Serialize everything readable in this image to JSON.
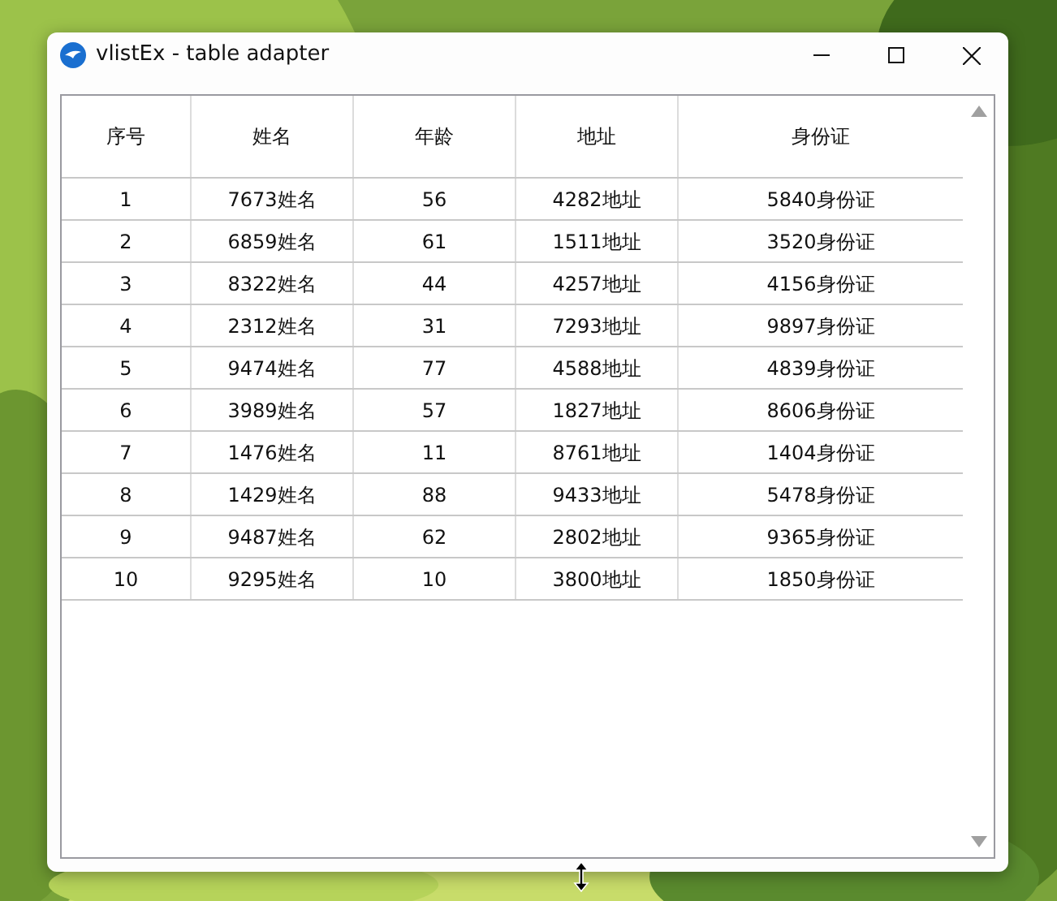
{
  "window": {
    "title": "vlistEx - table adapter"
  },
  "table": {
    "columns": [
      "序号",
      "姓名",
      "年龄",
      "地址",
      "身份证"
    ],
    "rows": [
      [
        "1",
        "7673姓名",
        "56",
        "4282地址",
        "5840身份证"
      ],
      [
        "2",
        "6859姓名",
        "61",
        "1511地址",
        "3520身份证"
      ],
      [
        "3",
        "8322姓名",
        "44",
        "4257地址",
        "4156身份证"
      ],
      [
        "4",
        "2312姓名",
        "31",
        "7293地址",
        "9897身份证"
      ],
      [
        "5",
        "9474姓名",
        "77",
        "4588地址",
        "4839身份证"
      ],
      [
        "6",
        "3989姓名",
        "57",
        "1827地址",
        "8606身份证"
      ],
      [
        "7",
        "1476姓名",
        "11",
        "8761地址",
        "1404身份证"
      ],
      [
        "8",
        "1429姓名",
        "88",
        "9433地址",
        "5478身份证"
      ],
      [
        "9",
        "9487姓名",
        "62",
        "2802地址",
        "9365身份证"
      ],
      [
        "10",
        "9295姓名",
        "10",
        "3800地址",
        "1850身份证"
      ]
    ]
  }
}
